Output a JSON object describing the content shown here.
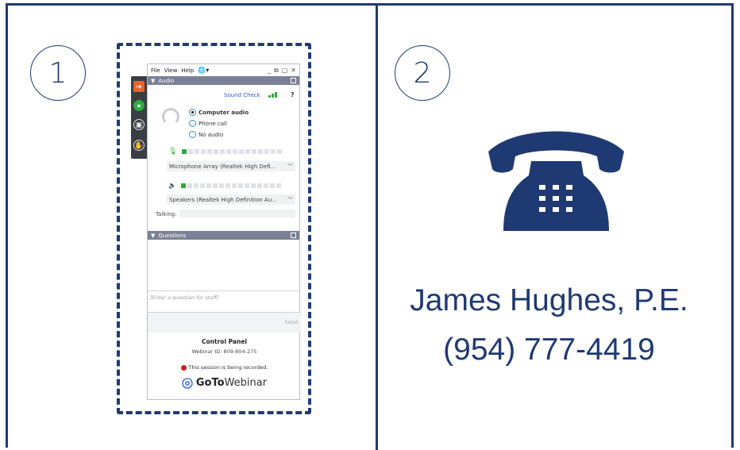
{
  "steps": {
    "one": "1",
    "two": "2"
  },
  "gtw": {
    "menu": [
      "File",
      "View",
      "Help"
    ],
    "audio_header": "Audio",
    "sound_check": "Sound Check",
    "help_symbol": "?",
    "audio_options": [
      "Computer audio",
      "Phone call",
      "No audio"
    ],
    "selected_audio": "Computer audio",
    "microphone": "Microphone Array (Realtek High Defi...",
    "speakers": "Speakers (Realtek High Definition Au...",
    "talking_label": "Talking:",
    "questions_header": "Questions",
    "question_placeholder": "[Enter a question for staff]",
    "send_label": "Send",
    "control_panel": "Control Panel",
    "webinar_id": "Webinar ID: 809-804-275",
    "recording_notice": "This session is being recorded.",
    "logo_bold": "GoTo",
    "logo_rest": "Webinar"
  },
  "contact": {
    "name": "James Hughes, P.E.",
    "phone": "(954) 777-4419"
  },
  "colors": {
    "navy": "#1f3a73",
    "green": "#2eab3c",
    "orange": "#e8632b",
    "record_red": "#d0201a"
  },
  "icons": [
    "telephone-icon",
    "headset-icon",
    "microphone-icon",
    "speaker-icon",
    "globe-icon",
    "raise-hand-icon",
    "screen-icon",
    "arrow-right-icon",
    "minimize-icon",
    "popout-icon",
    "close-icon",
    "gotowebinar-logo-icon",
    "record-dot-icon"
  ]
}
